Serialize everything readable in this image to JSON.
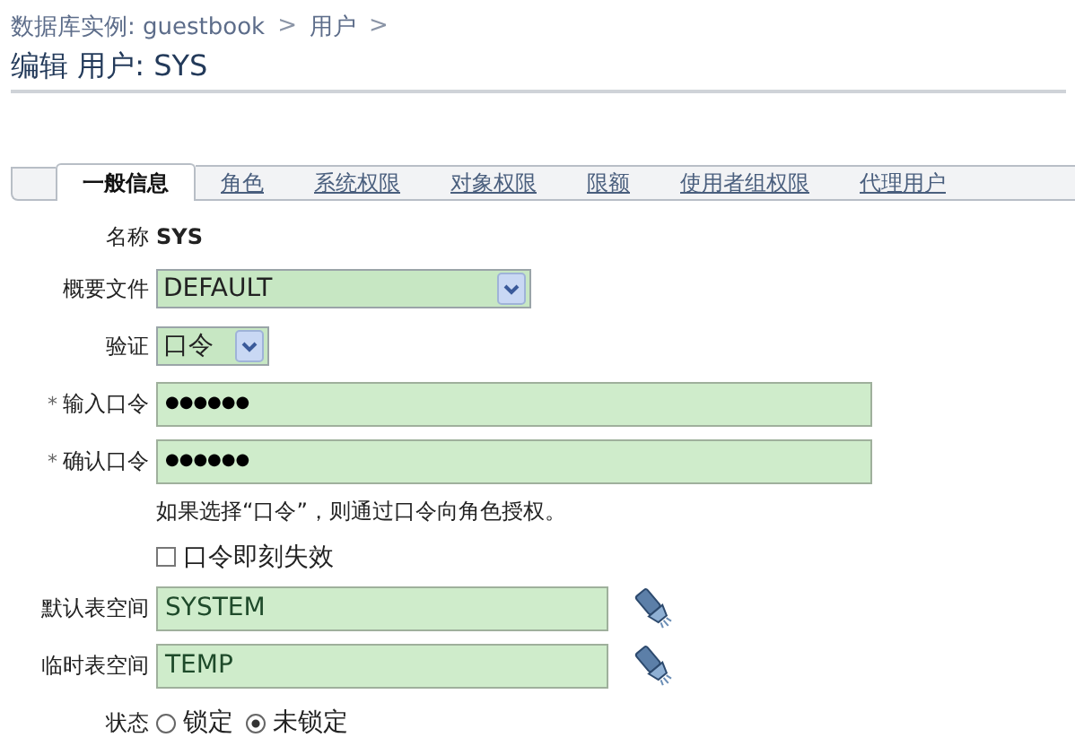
{
  "breadcrumb": [
    {
      "text": "数据库实例: guestbook",
      "kind": "link"
    },
    {
      "text": ">",
      "kind": "sep"
    },
    {
      "text": "用户",
      "kind": "link"
    },
    {
      "text": ">",
      "kind": "sep"
    }
  ],
  "page_title": "编辑  用户: SYS",
  "tabs": [
    {
      "label": "一般信息",
      "selected": true
    },
    {
      "label": "角色",
      "selected": false
    },
    {
      "label": "系统权限",
      "selected": false
    },
    {
      "label": "对象权限",
      "selected": false
    },
    {
      "label": "限额",
      "selected": false
    },
    {
      "label": "使用者组权限",
      "selected": false
    },
    {
      "label": "代理用户",
      "selected": false
    }
  ],
  "form": [
    {
      "kind": "text",
      "label": "名称",
      "value": "SYS"
    },
    {
      "kind": "listbox",
      "label": "概要文件",
      "value": "DEFAULT"
    },
    {
      "kind": "select",
      "label": "验证",
      "value": "口令"
    },
    {
      "kind": "password",
      "label": "输入口令",
      "required_mark": "*",
      "value": "●●●●●●"
    },
    {
      "kind": "password",
      "label": "确认口令",
      "required_mark": "*",
      "value": "●●●●●●"
    },
    {
      "kind": "hint",
      "text": "如果选择“口令”，则通过口令向角色授权。"
    },
    {
      "kind": "checkbox",
      "label": "口令即刻失效",
      "checked": false
    },
    {
      "kind": "lookup",
      "label": "默认表空间",
      "value": "SYSTEM"
    },
    {
      "kind": "lookup",
      "label": "临时表空间",
      "value": "TEMP"
    },
    {
      "kind": "radio",
      "label": "状态",
      "options": [
        {
          "label": "锁定",
          "selected": false
        },
        {
          "label": "未锁定",
          "selected": true
        }
      ]
    }
  ]
}
